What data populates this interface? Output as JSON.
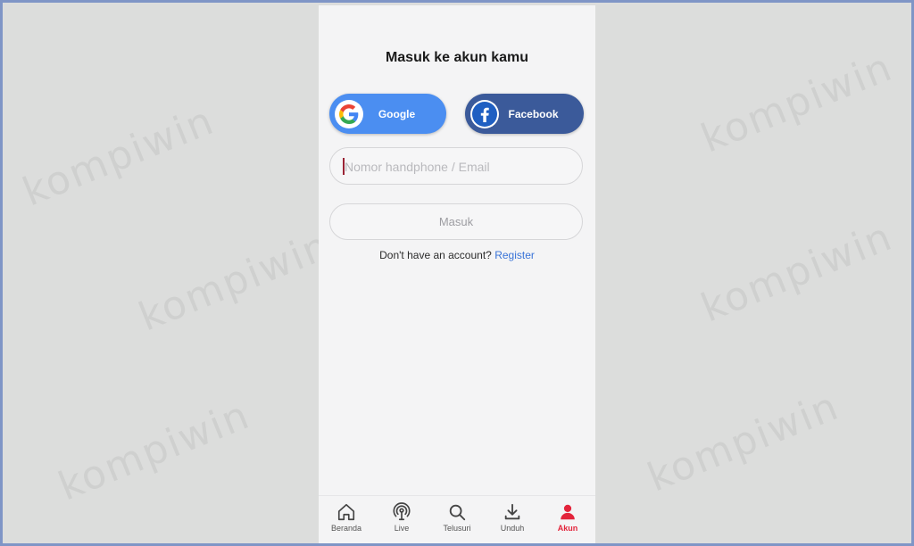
{
  "login": {
    "title": "Masuk ke akun kamu",
    "google_label": "Google",
    "facebook_label": "Facebook",
    "phone_email_placeholder": "Nomor handphone / Email",
    "submit_label": "Masuk",
    "no_account_text": "Don't have an account?",
    "register_link": "Register"
  },
  "bottom_nav": [
    {
      "label": "Beranda",
      "icon": "home-icon",
      "active": false
    },
    {
      "label": "Live",
      "icon": "live-icon",
      "active": false
    },
    {
      "label": "Telusuri",
      "icon": "search-icon",
      "active": false
    },
    {
      "label": "Unduh",
      "icon": "download-icon",
      "active": false
    },
    {
      "label": "Akun",
      "icon": "user-icon",
      "active": true
    }
  ],
  "watermark": "kompiwin",
  "colors": {
    "google_button": "#4b8ef1",
    "facebook_button": "#3b5a9a",
    "active_nav": "#e3243b",
    "link": "#3a74d8"
  }
}
